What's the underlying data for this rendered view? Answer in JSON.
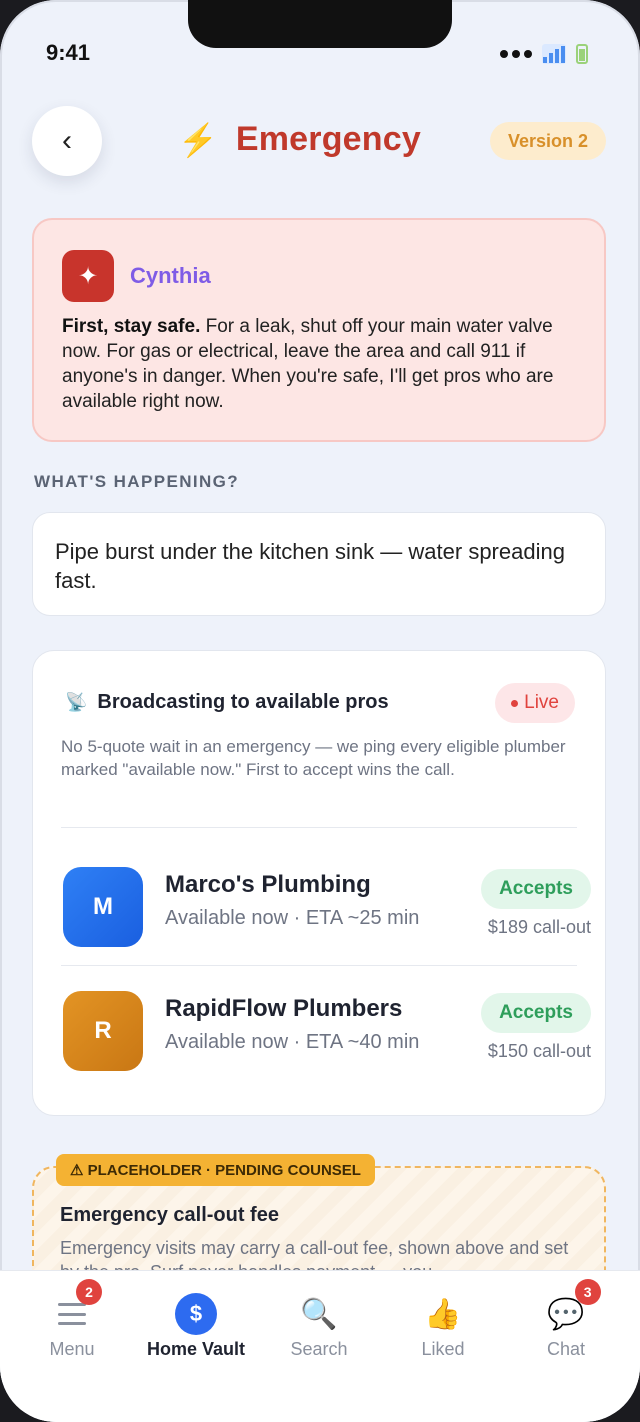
{
  "status": {
    "time": "9:41"
  },
  "header": {
    "title": "Emergency",
    "version": "Version 2"
  },
  "assistant": {
    "name": "Cynthia",
    "message_bold": "First, stay safe.",
    "message": " For a leak, shut off your main water valve now. For gas or electrical, leave the area and call 911 if anyone's in danger. When you're safe, I'll get pros who are available right now."
  },
  "happening": {
    "label": "WHAT'S HAPPENING?",
    "text": "Pipe burst under the kitchen sink — water spreading fast."
  },
  "broadcast": {
    "title": "Broadcasting to available pros",
    "live_label": "Live",
    "description": "No 5-quote wait in an emergency — we ping every eligible plumber marked \"available now.\" First to accept wins the call.",
    "pros": [
      {
        "initial": "M",
        "name": "Marco's Plumbing",
        "meta": "Available now · ETA ~25 min",
        "status": "Accepts",
        "fee": "$189 call-out"
      },
      {
        "initial": "R",
        "name": "RapidFlow Plumbers",
        "meta": "Available now · ETA ~40 min",
        "status": "Accepts",
        "fee": "$150 call-out"
      }
    ]
  },
  "placeholder": {
    "badge": "⚠ PLACEHOLDER · PENDING COUNSEL",
    "title": "Emergency call-out fee",
    "body": "Emergency visits may carry a call-out fee, shown above and set by the pro. Surf never handles payment — you"
  },
  "tabs": [
    {
      "label": "Menu",
      "badge": "2"
    },
    {
      "label": "Home Vault",
      "icon_text": "$"
    },
    {
      "label": "Search"
    },
    {
      "label": "Liked"
    },
    {
      "label": "Chat",
      "badge": "3"
    }
  ],
  "colors": {
    "accent_red": "#c0392b",
    "assistant_purple": "#7f5ce6",
    "accept_green": "#2e9e5b",
    "placeholder_amber": "#f4b233",
    "vault_blue": "#2d6bf0"
  }
}
